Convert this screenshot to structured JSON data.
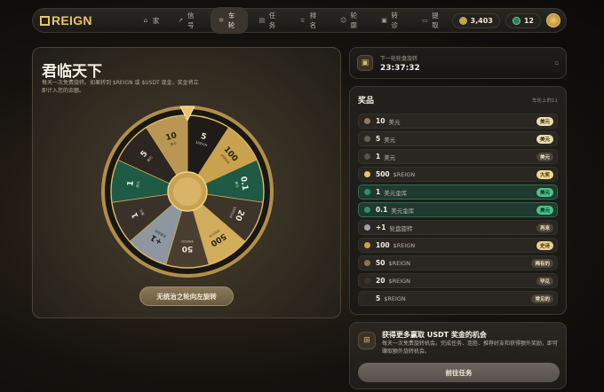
{
  "brand": {
    "logo_text": "REIGN",
    "accent": "#e9c46a"
  },
  "nav": {
    "items": [
      {
        "label": "家",
        "icon": "home-icon",
        "active": false
      },
      {
        "label": "信号",
        "icon": "trend-icon",
        "active": false
      },
      {
        "label": "车轮",
        "icon": "wheel-icon",
        "active": true
      },
      {
        "label": "任务",
        "icon": "clipboard-icon",
        "active": false
      },
      {
        "label": "排名",
        "icon": "trophy-icon",
        "active": false
      },
      {
        "label": "轮廓",
        "icon": "user-icon",
        "active": false
      },
      {
        "label": "转诊",
        "icon": "gift-icon",
        "active": false
      },
      {
        "label": "提取",
        "icon": "wallet-icon",
        "active": false
      }
    ],
    "coins": "3,403",
    "gems": "12"
  },
  "wheel_panel": {
    "title": "君临天下",
    "description": "每天一次免费旋转。如果转到 $REIGN 或 $USDT 现金，奖金将立即计入您的余额。",
    "spin_button": "无统治之轮向左旋转",
    "segments": [
      {
        "value": "5",
        "sub": "$REIGN",
        "color": "#1e1b18",
        "text": "#ece4d2"
      },
      {
        "value": "100",
        "sub": "$REIGN",
        "color": "#c9a24d",
        "text": "#2a2218"
      },
      {
        "value": "0.1",
        "sub": "美元",
        "color": "#1f5a45",
        "text": "#e8f5ee"
      },
      {
        "value": "20",
        "sub": "$REIGN",
        "color": "#3d342a",
        "text": "#ece4d2"
      },
      {
        "value": "500",
        "sub": "$REIGN",
        "color": "#d2ad5c",
        "text": "#2a2218"
      },
      {
        "value": "50",
        "sub": "$REIGN",
        "color": "#4a3e30",
        "text": "#ece4d2"
      },
      {
        "value": "+1",
        "sub": "轮盘旋转",
        "color": "#8e97a0",
        "text": "#1c1c1c"
      },
      {
        "value": "1",
        "sub": "美元",
        "color": "#3a322a",
        "text": "#ece4d2"
      },
      {
        "value": "1",
        "sub": "美元",
        "color": "#1f5a45",
        "text": "#e8f5ee"
      },
      {
        "value": "5",
        "sub": "美元",
        "color": "#2b2621",
        "text": "#ece4d2"
      },
      {
        "value": "10",
        "sub": "美元",
        "color": "#b99752",
        "text": "#2a2218"
      }
    ]
  },
  "timer": {
    "label": "下一轮轮盘旋转",
    "value": "23:37:32"
  },
  "prizes": {
    "title": "奖品",
    "subtitle": "车轮上的11",
    "items": [
      {
        "amount": "10",
        "unit": "美元",
        "tag": "美元",
        "dot": "#8a7b62",
        "green": false,
        "tag_bg": "#e9dcae",
        "tag_fg": "#3a2f1a"
      },
      {
        "amount": "5",
        "unit": "美元",
        "tag": "美元",
        "dot": "#6a5e4c",
        "green": false,
        "tag_bg": "#e9dcae",
        "tag_fg": "#3a2f1a"
      },
      {
        "amount": "1",
        "unit": "美元",
        "tag": "美元",
        "dot": "#5a5047",
        "green": false,
        "tag_bg": "#4a4336",
        "tag_fg": "#e9dfca"
      },
      {
        "amount": "500",
        "unit": "$REIGN",
        "tag": "大奖",
        "dot": "#e9c46a",
        "green": false,
        "tag_bg": "#f0d78a",
        "tag_fg": "#3a2f1a"
      },
      {
        "amount": "1",
        "unit": "美元金库",
        "tag": "美元",
        "dot": "#2f8f68",
        "green": true,
        "tag_bg": "#49c48c",
        "tag_fg": "#0f2a1f"
      },
      {
        "amount": "0.1",
        "unit": "美元金库",
        "tag": "美元",
        "dot": "#2f8f68",
        "green": true,
        "tag_bg": "#49c48c",
        "tag_fg": "#0f2a1f"
      },
      {
        "amount": "+1",
        "unit": "轮盘旋转",
        "tag": "再来",
        "dot": "#9aa3ab",
        "green": false,
        "tag_bg": "#4a4336",
        "tag_fg": "#e9dfca"
      },
      {
        "amount": "100",
        "unit": "$REIGN",
        "tag": "史诗",
        "dot": "#c9a24d",
        "green": false,
        "tag_bg": "#e9d08a",
        "tag_fg": "#3a2f1a"
      },
      {
        "amount": "50",
        "unit": "$REIGN",
        "tag": "稀有的",
        "dot": "#8a7450",
        "green": false,
        "tag_bg": "#4a4336",
        "tag_fg": "#e9dfca"
      },
      {
        "amount": "20",
        "unit": "$REIGN",
        "tag": "罕见",
        "dot": "#3d342a",
        "green": false,
        "tag_bg": "#4a4336",
        "tag_fg": "#e9dfca"
      },
      {
        "amount": "5",
        "unit": "$REIGN",
        "tag": "常见的",
        "dot": "#2a2520",
        "green": false,
        "tag_bg": "#4a4336",
        "tag_fg": "#e9dfca"
      }
    ]
  },
  "promo": {
    "title": "获得更多赢取 USDT 奖金的机会",
    "description": "每天一次免费旋转机会。完成任务、连胜、推荐好友和获得额外奖励，即可赚取额外旋转机会。",
    "button": "前往任务"
  }
}
